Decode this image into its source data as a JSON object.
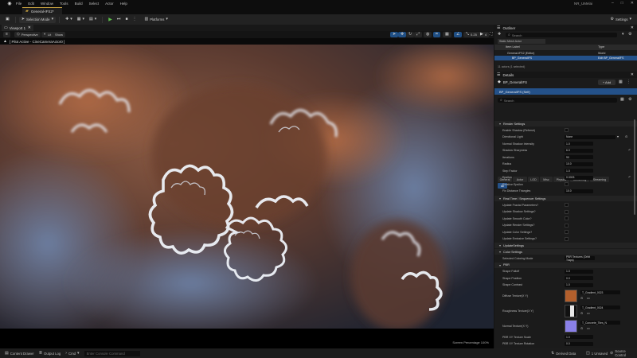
{
  "menubar": {
    "items": [
      "File",
      "Edit",
      "Window",
      "Tools",
      "Build",
      "Select",
      "Actor",
      "Help"
    ],
    "project": "NR_UMelai"
  },
  "tabstrip": {
    "tab": "General-IFS2*"
  },
  "toolbar": {
    "selection_mode": "Selection Mode",
    "platforms": "Platforms",
    "settings": "Settings"
  },
  "viewport": {
    "tab": "Viewport 1",
    "perspective": "Perspective",
    "lit": "Lit",
    "show": "Show",
    "pilot": "[ Pilot Active - CineCameraActor0 ]",
    "screen_pct": "Screen Percentage  100%",
    "right_nums": [
      "0.25",
      "4"
    ]
  },
  "outliner": {
    "title": "Outliner",
    "search_placeholder": "Search",
    "filter": "Static Mesh Actor",
    "col_label": "Item Label",
    "col_type": "Type",
    "rows": [
      {
        "label": "General-IFS2 (Editor)",
        "type": "World"
      },
      {
        "label": "BP_GeneralIFS",
        "type": "Edit BP_GeneralIFS"
      }
    ],
    "count": "11 actors (1 selected)"
  },
  "details": {
    "title": "Details",
    "actor": "BP_GeneralIFS",
    "add_label": "+ Add",
    "component": "BP_GeneralIFS (Self)",
    "search_placeholder": "Search",
    "cat_row1": [
      "General",
      "Actor",
      "LOD",
      "Misc",
      "Physics",
      "Rendering",
      "Streaming"
    ],
    "cat_row2": [
      "All"
    ],
    "render_section": "Render Settings",
    "render_rows": [
      {
        "label": "Enable Shadow (Refresh)",
        "type": "cb"
      },
      {
        "label": "Directional Light",
        "value": "None",
        "type": "sel"
      },
      {
        "label": "Normal Shadow Intensity",
        "value": "1.0"
      },
      {
        "label": "Shadow Sharpness",
        "value": "6.0"
      },
      {
        "label": "Iterations",
        "value": "90"
      },
      {
        "label": "Radius",
        "value": "10.0"
      },
      {
        "label": "Step Factor",
        "value": "1.0"
      },
      {
        "label": "Epsilon",
        "value": "0.0003"
      },
      {
        "label": "Relative Epsilon",
        "type": "cb"
      },
      {
        "label": "Fix Distance Triangles",
        "value": "10.0"
      }
    ],
    "rt_section": "Real Time / Sequencer Settings",
    "rt_rows": [
      "Update Fractal Parameters?",
      "Update Shadow Settings?",
      "Update Smooth Color?",
      "Update Render Settings?",
      "Update Color Settings?",
      "Update Emissive Settings?"
    ],
    "update_settings": "UpdateSettings",
    "color_section": "Color Settings",
    "coloring_mode_label": "Selected Coloring Mode",
    "coloring_mode": "PBR Textures (Orbit Traps)",
    "pbr_label": "PBR",
    "shape_rows": [
      {
        "label": "Shape Falloff",
        "value": "1.0"
      },
      {
        "label": "Shape Position",
        "value": "0.0"
      },
      {
        "label": "Shape Contrast",
        "value": "1.0"
      }
    ],
    "textures": [
      {
        "label": "Diffuse Texture(X Y)",
        "asset": "T_Gradient_0023",
        "color": "#b35f2c"
      },
      {
        "label": "Roughness Texture(X Y)",
        "asset": "T_Gradient_0024",
        "color": "#e8e8e8"
      },
      {
        "label": "Normal Texture(X Y)",
        "asset": "T_Concrete_Tiles_N",
        "color": "#8a80e8"
      }
    ],
    "tail_rows": [
      {
        "label": "PBR XY Texture Scale",
        "value": "1.0"
      },
      {
        "label": "PBR XY Texture Rotation",
        "value": "0.0"
      },
      {
        "label": "PBR XY Texture Offset",
        "value": "0.0"
      }
    ]
  },
  "statusbar": {
    "content_drawer": "Content Drawer",
    "output_log": "Output Log",
    "cmd": "Cmd",
    "cmd_placeholder": "Enter Console Command",
    "derived": "Derived Data",
    "unsaved": "1 Unsaved",
    "source_control": "Source Control"
  }
}
